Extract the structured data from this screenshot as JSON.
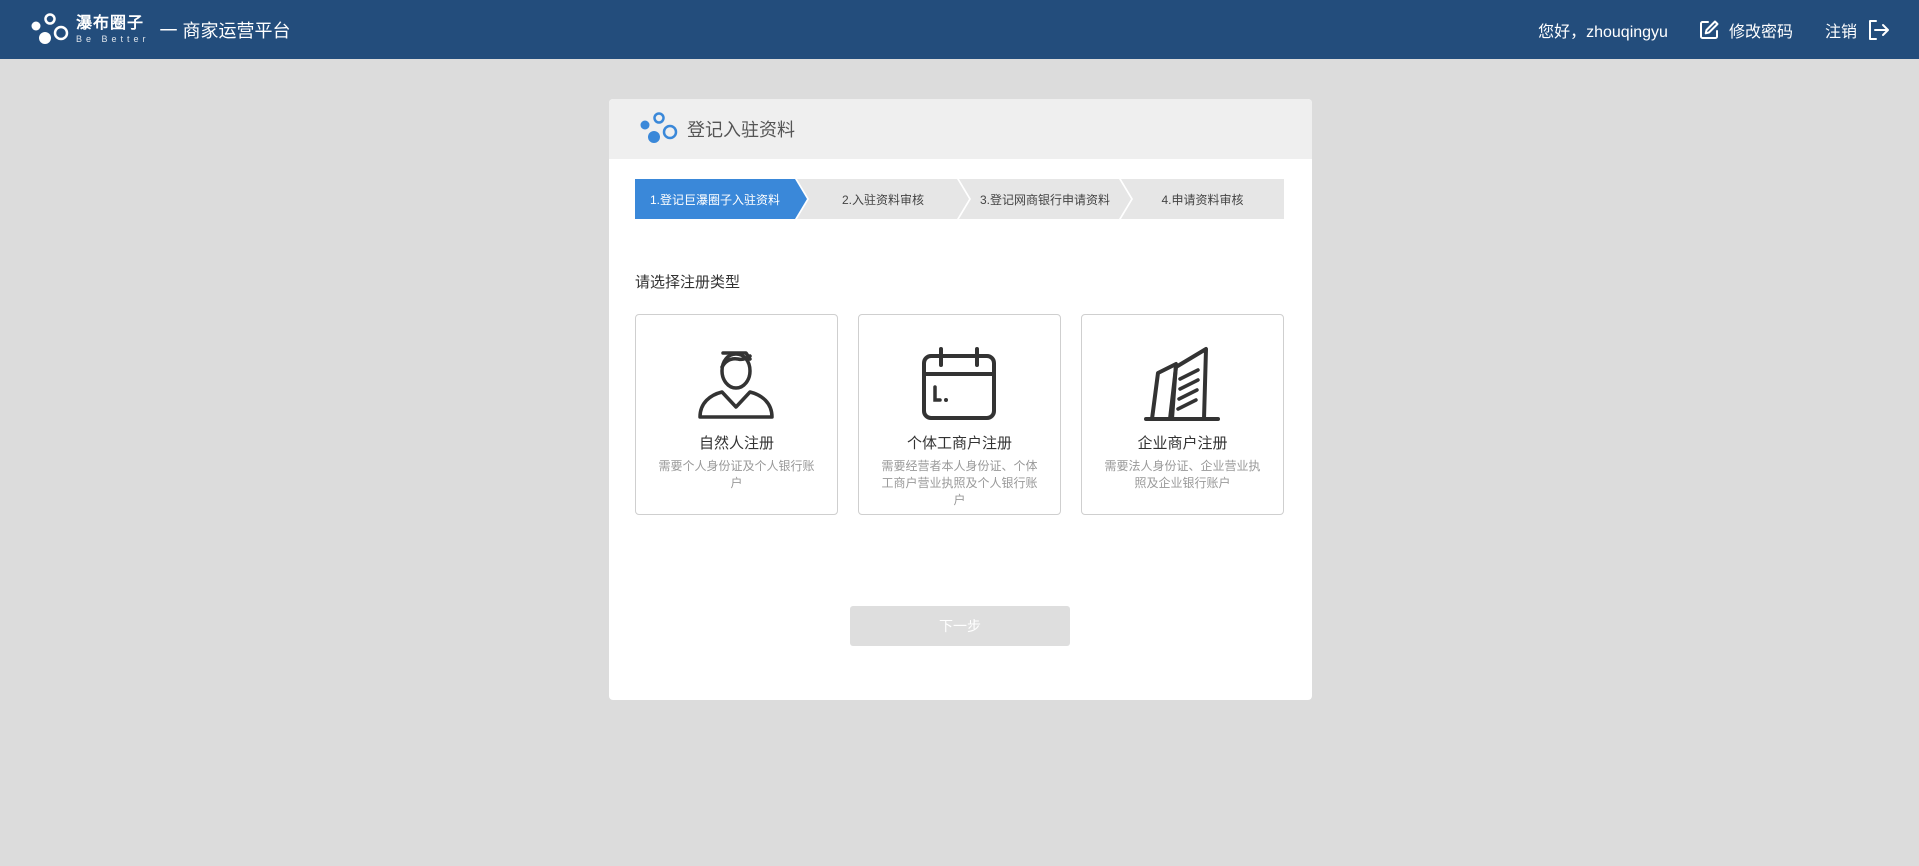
{
  "header": {
    "brand_name": "瀑布圈子",
    "brand_slogan": "Be Better",
    "platform_title": "一 商家运营平台",
    "greeting": "您好，zhouqingyu",
    "change_password": "修改密码",
    "logout": "注销",
    "bg_color": "#234d7c"
  },
  "card": {
    "title": "登记入驻资料",
    "steps": [
      {
        "label": "1.登记巨瀑圈子入驻资料",
        "active": true
      },
      {
        "label": "2.入驻资料审核",
        "active": false
      },
      {
        "label": "3.登记网商银行申请资料",
        "active": false
      },
      {
        "label": "4.申请资料审核",
        "active": false
      }
    ],
    "section_label": "请选择注册类型",
    "options": [
      {
        "icon": "person-icon",
        "title": "自然人注册",
        "desc": "需要个人身份证及个人银行账户"
      },
      {
        "icon": "calendar-icon",
        "title": "个体工商户注册",
        "desc": "需要经营者本人身份证、个体工商户营业执照及个人银行账户"
      },
      {
        "icon": "building-icon",
        "title": "企业商户注册",
        "desc": "需要法人身份证、企业营业执照及企业银行账户"
      }
    ],
    "next_button": "下一步",
    "accent_color": "#3a88d9"
  }
}
